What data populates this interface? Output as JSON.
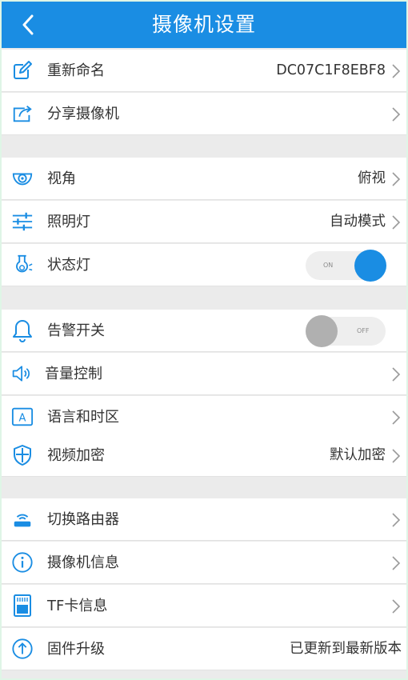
{
  "header": {
    "title": "摄像机设置",
    "back_icon": "chevron-left-icon",
    "color": "#1a8de3"
  },
  "colors": {
    "accent": "#1a8de3",
    "background": "#ebebeb",
    "row": "#ffffff",
    "toggle_off": "#b0b0b0"
  },
  "items": {
    "rename": {
      "label": "重新命名",
      "value": "DC07C1F8EBF8",
      "icon": "edit-icon"
    },
    "share": {
      "label": "分享摄像机",
      "icon": "share-icon"
    },
    "view_angle": {
      "label": "视角",
      "value": "俯视",
      "icon": "camera-view-icon"
    },
    "lighting": {
      "label": "照明灯",
      "value": "自动模式",
      "icon": "sliders-icon"
    },
    "status_light": {
      "label": "状态灯",
      "toggle": "ON",
      "on": true,
      "icon": "indicator-light-icon"
    },
    "alarm": {
      "label": "告警开关",
      "toggle": "OFF",
      "on": false,
      "icon": "bell-icon"
    },
    "volume": {
      "label": "音量控制",
      "icon": "speaker-icon"
    },
    "language": {
      "label": "语言和时区",
      "icon": "language-icon"
    },
    "encryption": {
      "label": "视频加密",
      "value": "默认加密",
      "icon": "shield-icon"
    },
    "router": {
      "label": "切换路由器",
      "icon": "router-icon"
    },
    "camera_info": {
      "label": "摄像机信息",
      "icon": "info-icon"
    },
    "tf_card": {
      "label": "TF卡信息",
      "icon": "sd-card-icon"
    },
    "firmware": {
      "label": "固件升级",
      "value": "已更新到最新版本",
      "icon": "upgrade-icon"
    }
  }
}
